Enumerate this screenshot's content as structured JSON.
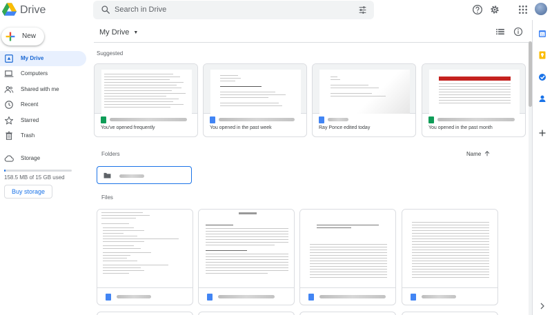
{
  "app": {
    "name": "Drive"
  },
  "search": {
    "placeholder": "Search in Drive"
  },
  "header_icons": [
    "help-icon",
    "settings-icon",
    "apps-grid-icon",
    "account-avatar"
  ],
  "sidebar": {
    "new_label": "New",
    "items": [
      {
        "label": "My Drive",
        "icon": "my-drive-icon",
        "active": true
      },
      {
        "label": "Computers",
        "icon": "computers-icon"
      },
      {
        "label": "Shared with me",
        "icon": "shared-icon"
      },
      {
        "label": "Recent",
        "icon": "clock-icon"
      },
      {
        "label": "Starred",
        "icon": "star-icon"
      },
      {
        "label": "Trash",
        "icon": "trash-icon"
      },
      {
        "label": "Storage",
        "icon": "cloud-icon"
      }
    ],
    "storage_used_fraction": 0.0105,
    "storage_text": "158.5 MB of 15 GB used",
    "buy_label": "Buy storage"
  },
  "main": {
    "title": "My Drive",
    "suggested_label": "Suggested",
    "suggested": [
      {
        "type": "sheet",
        "reason": "You've opened frequently"
      },
      {
        "type": "doc",
        "reason": "You opened in the past week"
      },
      {
        "type": "doc",
        "reason": "Ray Ponce edited today"
      },
      {
        "type": "sheet",
        "reason": "You opened in the past month"
      }
    ],
    "folders_label": "Folders",
    "sort_label": "Name",
    "files_label": "Files"
  },
  "colors": {
    "accent": "#1a73e8",
    "active_bg": "#e8f0fe",
    "sheet": "#0f9d58",
    "doc": "#4285f4"
  }
}
